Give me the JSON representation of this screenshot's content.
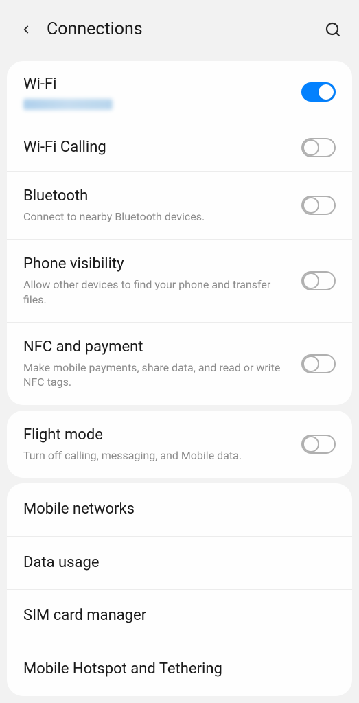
{
  "header": {
    "title": "Connections"
  },
  "group1": {
    "wifi": {
      "label": "Wi-Fi",
      "on": true
    },
    "wifiCalling": {
      "label": "Wi-Fi Calling",
      "on": false
    },
    "bluetooth": {
      "label": "Bluetooth",
      "desc": "Connect to nearby Bluetooth devices.",
      "on": false
    },
    "visibility": {
      "label": "Phone visibility",
      "desc": "Allow other devices to find your phone and transfer files.",
      "on": false
    },
    "nfc": {
      "label": "NFC and payment",
      "desc": "Make mobile payments, share data, and read or write NFC tags.",
      "on": false
    }
  },
  "group2": {
    "flight": {
      "label": "Flight mode",
      "desc": "Turn off calling, messaging, and Mobile data.",
      "on": false
    }
  },
  "group3": {
    "mobileNetworks": {
      "label": "Mobile networks"
    },
    "dataUsage": {
      "label": "Data usage"
    },
    "sim": {
      "label": "SIM card manager"
    },
    "hotspot": {
      "label": "Mobile Hotspot and Tethering"
    }
  }
}
